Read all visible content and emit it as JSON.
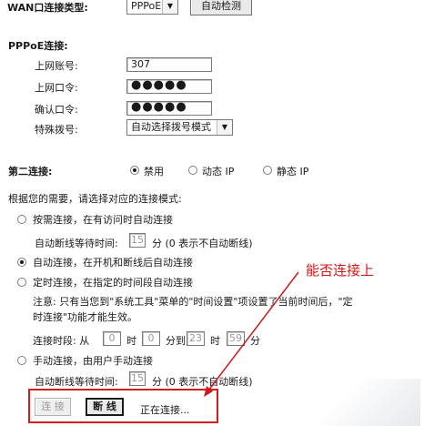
{
  "wan": {
    "type_label": "WAN口连接类型:",
    "type_value": "PPPoE",
    "detect_button": "自动检测"
  },
  "pppoe": {
    "section_label": "PPPoE连接:",
    "account_label": "上网账号:",
    "account_value": "307",
    "password_label": "上网口令:",
    "password_value": "●●●●●",
    "confirm_label": "确认口令:",
    "confirm_value": "●●●●●",
    "dial_label": "特殊拨号:",
    "dial_value": "自动选择拨号模式"
  },
  "second": {
    "label": "第二连接:",
    "options": [
      "禁用",
      "动态 IP",
      "静态 IP"
    ],
    "selected": 0
  },
  "mode": {
    "prompt": "根据您的需要，请选择对应的连接模式:",
    "on_demand": "按需连接，在有访问时自动连接",
    "on_demand_idle_label": "自动断线等待时间:",
    "on_demand_idle_value": "15",
    "on_demand_idle_unit": "分 (0 表示不自动断线)",
    "auto": "自动连接，在开机和断线后自动连接",
    "timed": "定时连接，在指定的时间段自动连接",
    "note_line1": "注意: 只有当您到\"系统工具\"菜单的\"时间设置\"项设置了当前时间后，\"定",
    "note_line2": "时连接\"功能才能生效。",
    "period_label": "连接时段: 从",
    "from_hour": "0",
    "hour_unit": "时",
    "from_min": "0",
    "to_label": "分到",
    "to_hour": "23",
    "to_min": "59",
    "min_unit": "分",
    "manual": "手动连接，由用户手动连接",
    "manual_idle_label": "自动断线等待时间:",
    "manual_idle_value": "15",
    "manual_idle_unit": "分 (0 表示不自动断线)",
    "selected": 1
  },
  "actions": {
    "connect": "连 接",
    "disconnect": "断 线",
    "status": "正在连接..."
  },
  "annotation": {
    "text": "能否连接上",
    "color": "#d01a1a"
  }
}
